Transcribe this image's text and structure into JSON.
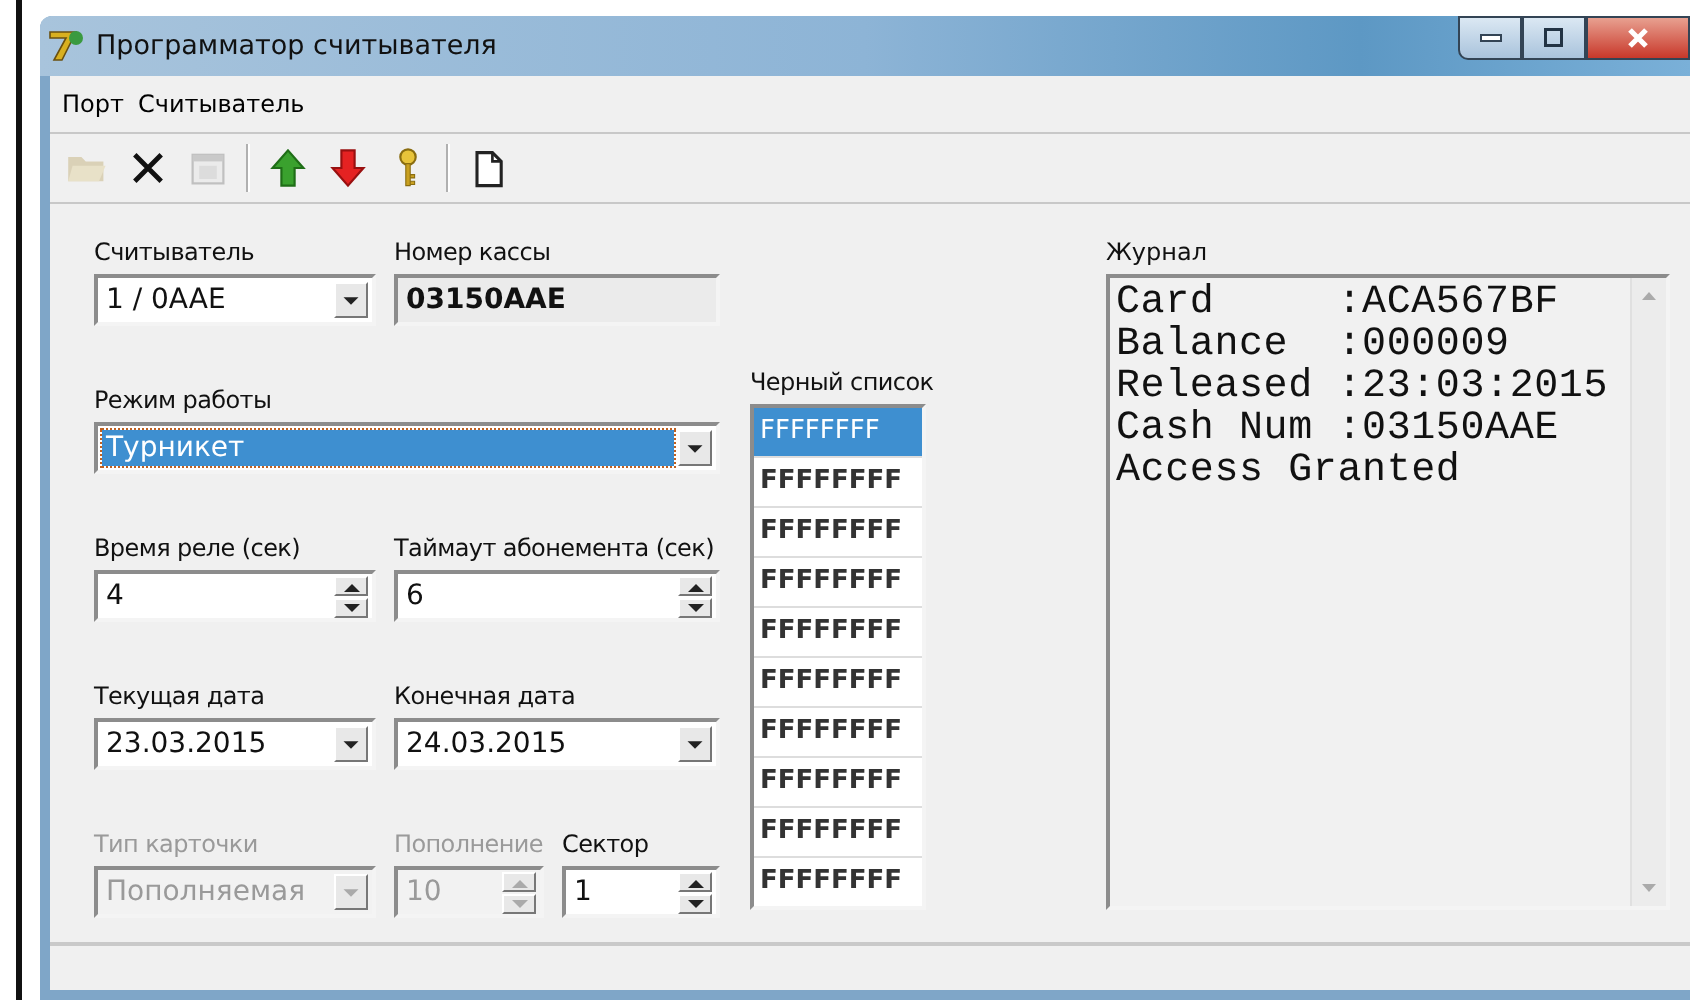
{
  "window": {
    "title": "Программатор считывателя"
  },
  "menu": [
    {
      "label": "Порт"
    },
    {
      "label": "Считыватель"
    }
  ],
  "toolbar": [
    {
      "kind": "open",
      "disabled": true
    },
    {
      "kind": "delete",
      "disabled": false
    },
    {
      "kind": "properties",
      "disabled": true
    },
    {
      "kind": "separator"
    },
    {
      "kind": "up",
      "disabled": false
    },
    {
      "kind": "down",
      "disabled": false
    },
    {
      "kind": "key",
      "disabled": false
    },
    {
      "kind": "separator"
    },
    {
      "kind": "new",
      "disabled": false
    }
  ],
  "form": [
    [
      {
        "kind": "combo",
        "label": "Считыватель",
        "value": "1 / 0AAE",
        "disabled": false,
        "highlighted": false
      },
      {
        "kind": "readonly",
        "label": "Номер кассы",
        "value": "03150AAE",
        "disabled": false,
        "highlighted": false
      }
    ],
    [
      {
        "kind": "combo",
        "label": "Режим работы",
        "value": "Турникет",
        "disabled": false,
        "highlighted": true
      }
    ],
    [
      {
        "kind": "spin",
        "label": "Время реле (сек)",
        "value": "4",
        "disabled": false,
        "highlighted": false
      },
      {
        "kind": "spin",
        "label": "Таймаут абонемента (сек)",
        "value": "6",
        "disabled": false,
        "highlighted": false
      }
    ],
    [
      {
        "kind": "combo",
        "label": "Текущая дата",
        "value": "23.03.2015",
        "disabled": false,
        "highlighted": false
      },
      {
        "kind": "combo",
        "label": "Конечная дата",
        "value": "24.03.2015",
        "disabled": false,
        "highlighted": false
      }
    ],
    [
      {
        "kind": "combo",
        "label": "Тип карточки",
        "value": "Пополняемая",
        "disabled": true,
        "highlighted": false
      },
      {
        "kind": "spin",
        "label": "Пополнение",
        "value": "10",
        "disabled": true,
        "highlighted": false
      },
      {
        "kind": "spin",
        "label": "Сектор",
        "value": "1",
        "disabled": false,
        "highlighted": false
      }
    ]
  ],
  "blacklist": {
    "label": "Черный список",
    "items": [
      {
        "text": "FFFFFFFF",
        "selected": true
      },
      {
        "text": "FFFFFFFF",
        "selected": false
      },
      {
        "text": "FFFFFFFF",
        "selected": false
      },
      {
        "text": "FFFFFFFF",
        "selected": false
      },
      {
        "text": "FFFFFFFF",
        "selected": false
      },
      {
        "text": "FFFFFFFF",
        "selected": false
      },
      {
        "text": "FFFFFFFF",
        "selected": false
      },
      {
        "text": "FFFFFFFF",
        "selected": false
      },
      {
        "text": "FFFFFFFF",
        "selected": false
      },
      {
        "text": "FFFFFFFF",
        "selected": false
      }
    ]
  },
  "log": {
    "label": "Журнал",
    "lines": [
      "Card     :ACA567BF",
      "Balance  :000009",
      "Released :23:03:2015",
      "Cash Num :03150AAE",
      "Access Granted"
    ]
  }
}
